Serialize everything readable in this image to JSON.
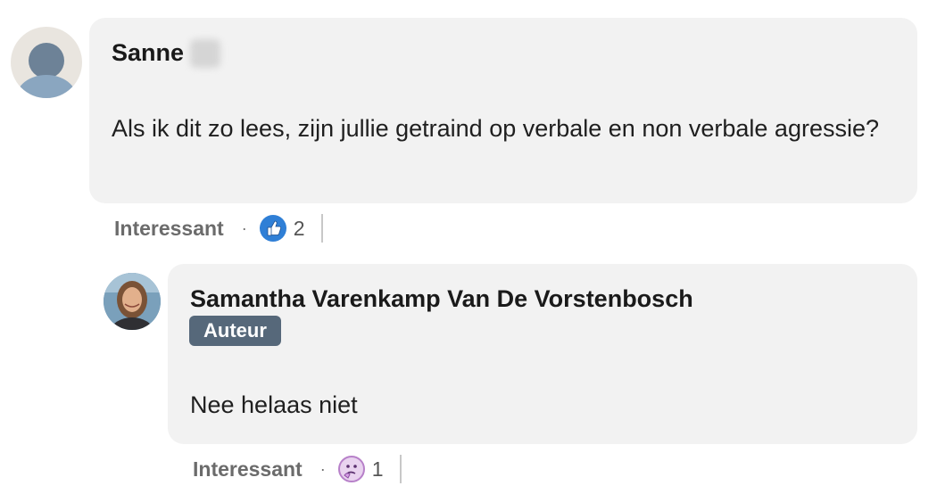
{
  "comments": [
    {
      "author": "Sanne",
      "text": "Als ik dit zo lees, zijn jullie getraind op verbale en non verbale agressie?",
      "action_label": "Interessant",
      "reaction_icon": "thumbs-up-icon",
      "reaction_count": "2"
    },
    {
      "author": "Samantha Varenkamp Van De Vorstenbosch",
      "badge": "Auteur",
      "text": "Nee helaas niet",
      "action_label": "Interessant",
      "reaction_icon": "thinking-face-icon",
      "reaction_count": "1"
    }
  ],
  "separator": "·",
  "colors": {
    "bubble": "#f2f2f2",
    "badge": "#56687a",
    "like": "#2f7fd6",
    "curious": "#c7a3d6"
  }
}
